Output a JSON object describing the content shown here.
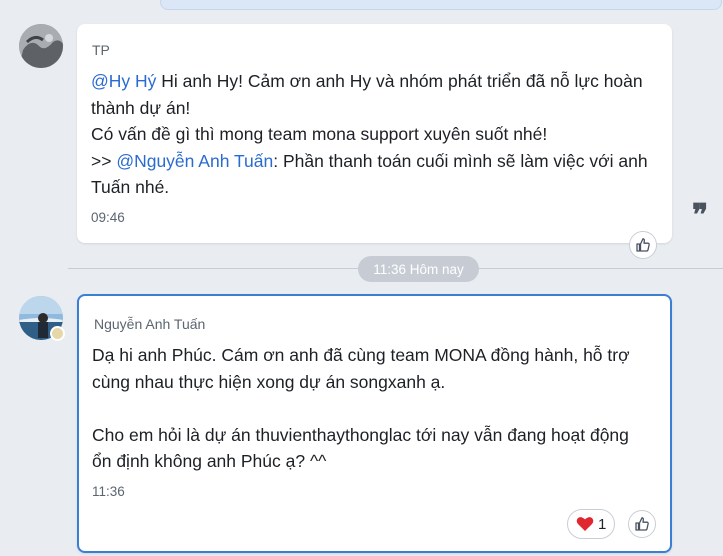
{
  "messages": [
    {
      "sender": "TP",
      "lines": [
        [
          {
            "text": "@Hy Hý",
            "mention": true
          },
          {
            "text": " Hi anh Hy! Cảm ơn anh Hy và nhóm phát triển đã nỗ lực hoàn",
            "mention": false
          }
        ],
        [
          {
            "text": "thành dự án!",
            "mention": false
          }
        ],
        [
          {
            "text": "Có vấn đề gì thì mong team mona support xuyên suốt nhé!",
            "mention": false
          }
        ],
        [
          {
            "text": ">> ",
            "mention": false
          },
          {
            "text": "@Nguyễn Anh Tuấn",
            "mention": true
          },
          {
            "text": ": Phần thanh toán cuối mình sẽ làm việc với anh",
            "mention": false
          }
        ],
        [
          {
            "text": "Tuấn nhé.",
            "mention": false
          }
        ]
      ],
      "time": "09:46",
      "like_icon": "thumbs-up-icon"
    },
    {
      "sender": "Nguyễn Anh Tuấn",
      "lines": [
        [
          {
            "text": "Dạ hi anh Phúc. Cám ơn anh đã cùng team MONA đồng hành, hỗ trợ",
            "mention": false
          }
        ],
        [
          {
            "text": "cùng nhau thực hiện xong dự án songxanh ạ.",
            "mention": false
          }
        ],
        [
          {
            "text": "",
            "mention": false
          }
        ],
        [
          {
            "text": "Cho em hỏi là dự án thuvienthaythonglac tới nay vẫn đang hoạt động",
            "mention": false
          }
        ],
        [
          {
            "text": "ổn định không anh Phúc ạ? ^^",
            "mention": false
          }
        ]
      ],
      "time": "11:36",
      "reaction": {
        "icon": "heart-icon",
        "count": "1"
      },
      "like_icon": "thumbs-up-icon"
    }
  ],
  "date_divider": "11:36 Hôm nay",
  "quote_icon": "quote-icon",
  "colors": {
    "background": "#e9ecf1",
    "mention": "#2a6bd1",
    "highlight_border": "#3b7fd4",
    "heart": "#e0262f"
  }
}
